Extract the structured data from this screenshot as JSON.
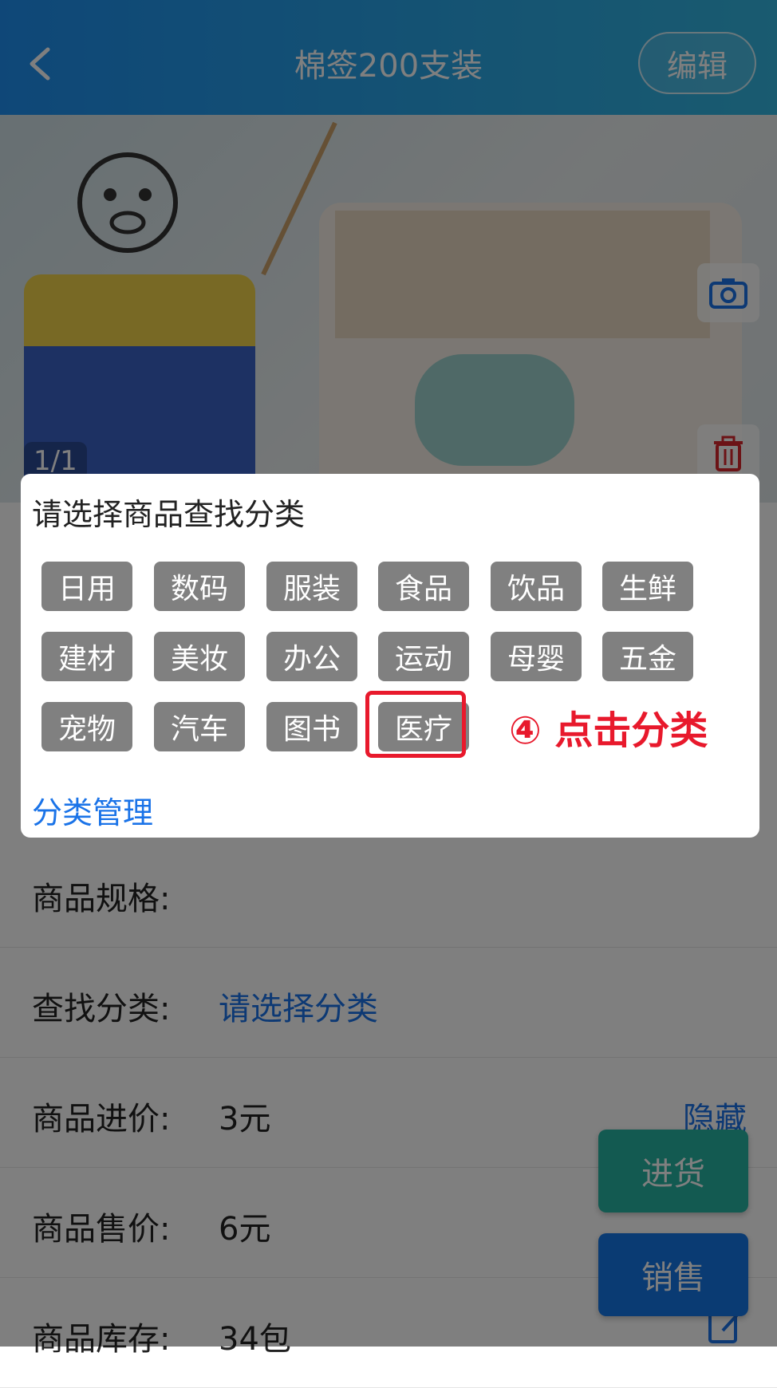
{
  "header": {
    "title": "棉签200支装",
    "edit_label": "编辑"
  },
  "photo": {
    "page_indicator": "1/1"
  },
  "form": {
    "spec_label": "商品规格:",
    "category_label": "查找分类:",
    "category_value": "请选择分类",
    "cost_label": "商品进价:",
    "cost_value": "3元",
    "hide_label": "隐藏",
    "price_label": "商品售价:",
    "price_value": "6元",
    "stock_label": "商品库存:",
    "stock_value": "34包"
  },
  "actions": {
    "restock_label": "进货",
    "sell_label": "销售"
  },
  "dialog": {
    "title": "请选择商品查找分类",
    "categories": [
      "日用",
      "数码",
      "服装",
      "食品",
      "饮品",
      "生鲜",
      "建材",
      "美妆",
      "办公",
      "运动",
      "母婴",
      "五金",
      "宠物",
      "汽车",
      "图书",
      "医疗"
    ],
    "manage_label": "分类管理",
    "annotation": "④ 点击分类"
  },
  "colors": {
    "header_start": "#1e8ff0",
    "header_end": "#33b6e0",
    "link": "#1a73e8",
    "chip": "#808080",
    "annotation": "#e8192c",
    "restock": "#26b5a3",
    "sell": "#1576e6"
  },
  "icons": {
    "back": "chevron-left-icon",
    "camera": "camera-icon",
    "delete": "trash-icon",
    "edit_note": "edit-note-icon"
  }
}
